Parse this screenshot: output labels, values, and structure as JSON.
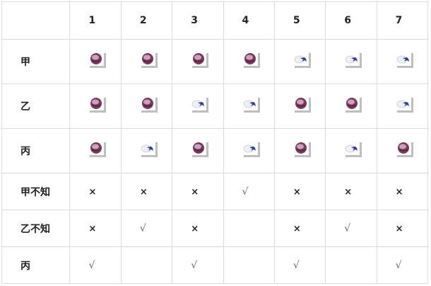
{
  "header": [
    "",
    "1",
    "2",
    "3",
    "4",
    "5",
    "6",
    "7"
  ],
  "image_rows": [
    {
      "label": "甲",
      "cells": [
        "red-cap",
        "red-cap",
        "red-cap",
        "red-cap",
        "white-cap",
        "white-cap",
        "white-cap"
      ]
    },
    {
      "label": "乙",
      "cells": [
        "red-cap",
        "red-cap",
        "white-cap",
        "white-cap",
        "red-cap",
        "red-cap",
        "white-cap"
      ]
    },
    {
      "label": "丙",
      "cells": [
        "red-cap",
        "white-cap",
        "red-cap",
        "white-cap",
        "red-cap",
        "white-cap",
        "red-cap"
      ]
    }
  ],
  "mark_rows": [
    {
      "label": "甲不知",
      "cells": [
        "×",
        "×",
        "×",
        "√",
        "×",
        "×",
        "×"
      ]
    },
    {
      "label": "乙不知",
      "cells": [
        "×",
        "√",
        "×",
        "",
        "×",
        "√",
        "×"
      ]
    },
    {
      "label": "丙",
      "cells": [
        "√",
        "",
        "√",
        "",
        "√",
        "",
        "√"
      ]
    }
  ]
}
